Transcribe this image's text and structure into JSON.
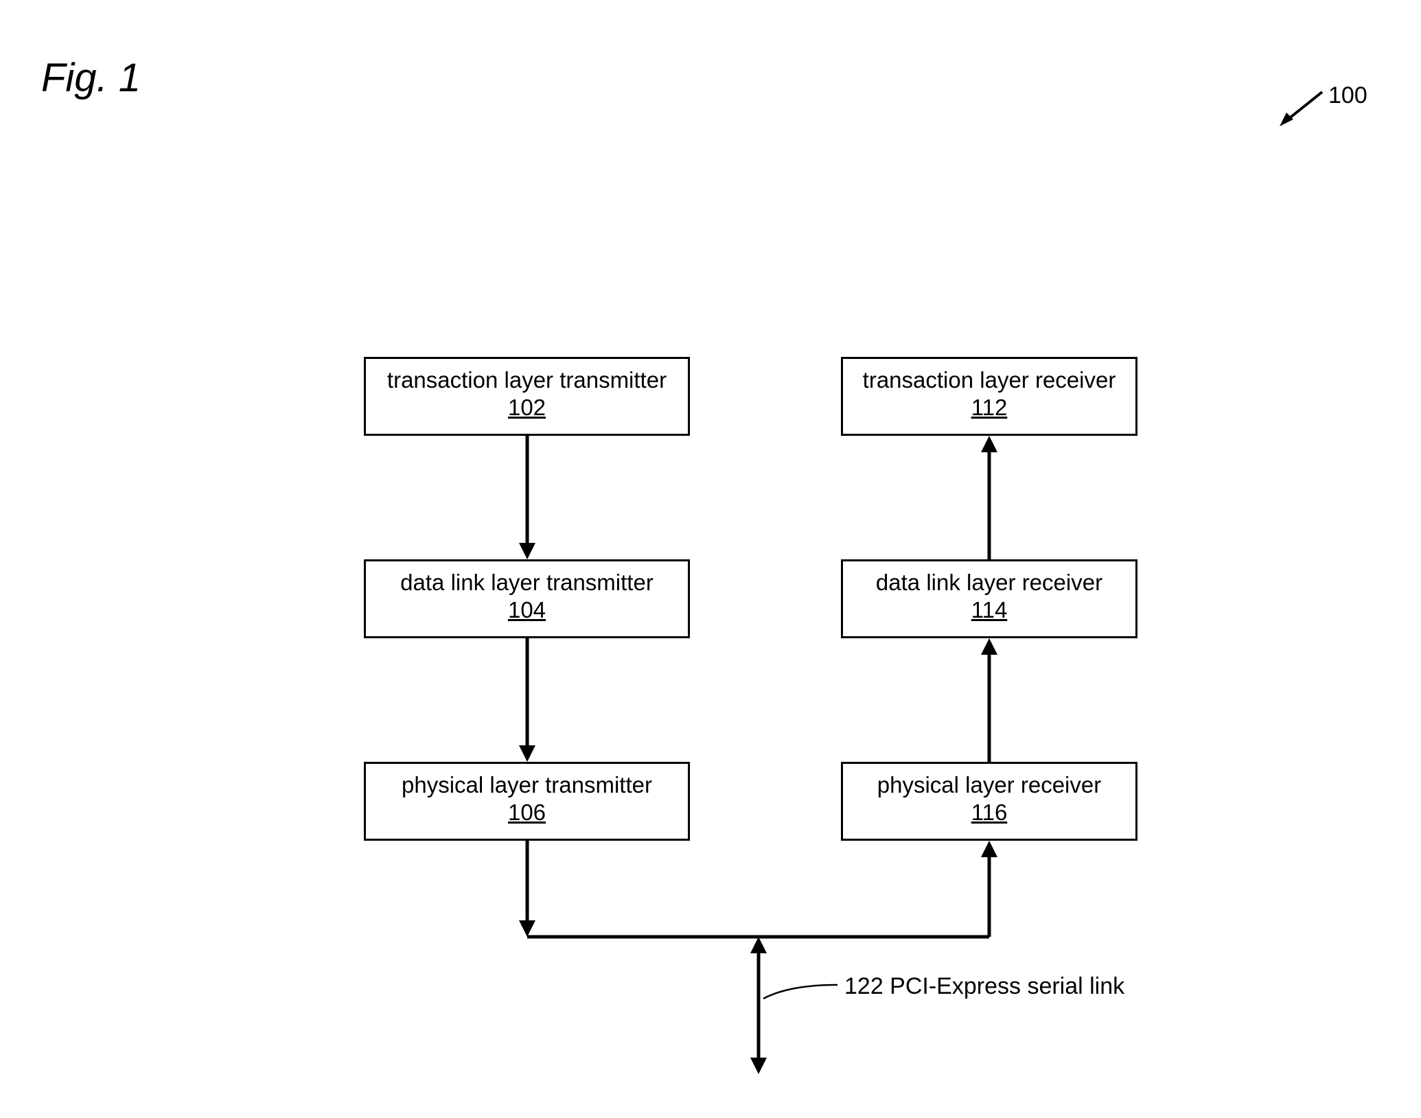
{
  "figure_title": "Fig. 1",
  "diagram_ref": "100",
  "link_label": "122 PCI-Express serial link",
  "boxes": {
    "tx_tl": {
      "label": "transaction layer transmitter",
      "num": "102"
    },
    "tx_dl": {
      "label": "data link layer transmitter",
      "num": "104"
    },
    "tx_phy": {
      "label": "physical layer transmitter",
      "num": "106"
    },
    "rx_tl": {
      "label": "transaction layer receiver",
      "num": "112"
    },
    "rx_dl": {
      "label": "data link layer receiver",
      "num": "114"
    },
    "rx_phy": {
      "label": "physical layer receiver",
      "num": "116"
    }
  }
}
